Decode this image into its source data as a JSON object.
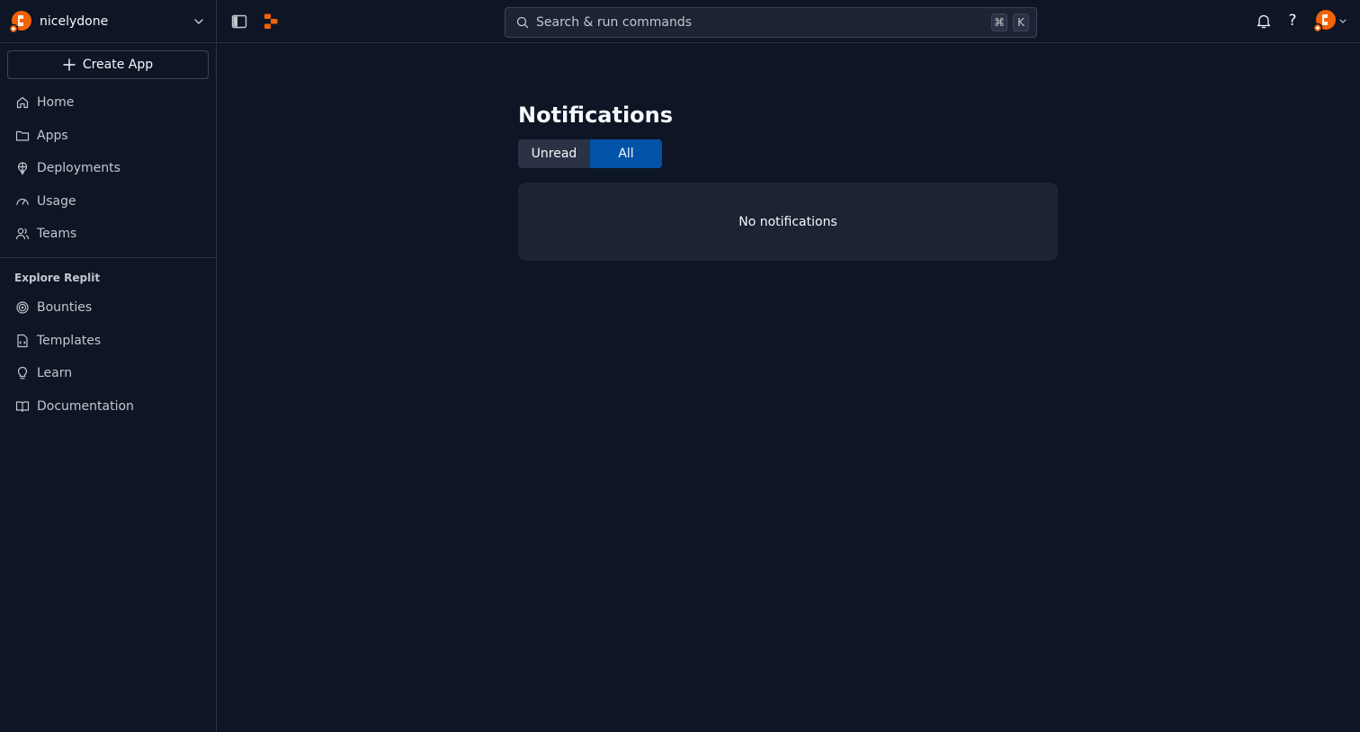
{
  "account": {
    "name": "nicelydone",
    "avatar_icon": "replit-avatar-icon"
  },
  "sidebar": {
    "create_label": "Create App",
    "items": [
      {
        "label": "Home",
        "icon": "home-icon"
      },
      {
        "label": "Apps",
        "icon": "folder-icon"
      },
      {
        "label": "Deployments",
        "icon": "deployments-icon"
      },
      {
        "label": "Usage",
        "icon": "gauge-icon"
      },
      {
        "label": "Teams",
        "icon": "users-icon"
      }
    ],
    "explore_label": "Explore Replit",
    "explore_items": [
      {
        "label": "Bounties",
        "icon": "target-icon"
      },
      {
        "label": "Templates",
        "icon": "template-file-icon"
      },
      {
        "label": "Learn",
        "icon": "lightbulb-icon"
      },
      {
        "label": "Documentation",
        "icon": "book-icon"
      }
    ]
  },
  "topbar": {
    "search_placeholder": "Search & run commands",
    "shortcut_keys": [
      "⌘",
      "K"
    ],
    "help_label": "?"
  },
  "main": {
    "title": "Notifications",
    "tabs": [
      {
        "label": "Unread",
        "active": false
      },
      {
        "label": "All",
        "active": true
      }
    ],
    "empty_text": "No notifications"
  },
  "colors": {
    "background": "#0e1525",
    "surface": "#1c2333",
    "border": "#2b3245",
    "accent": "#0053a6",
    "brand": "#f26207"
  }
}
